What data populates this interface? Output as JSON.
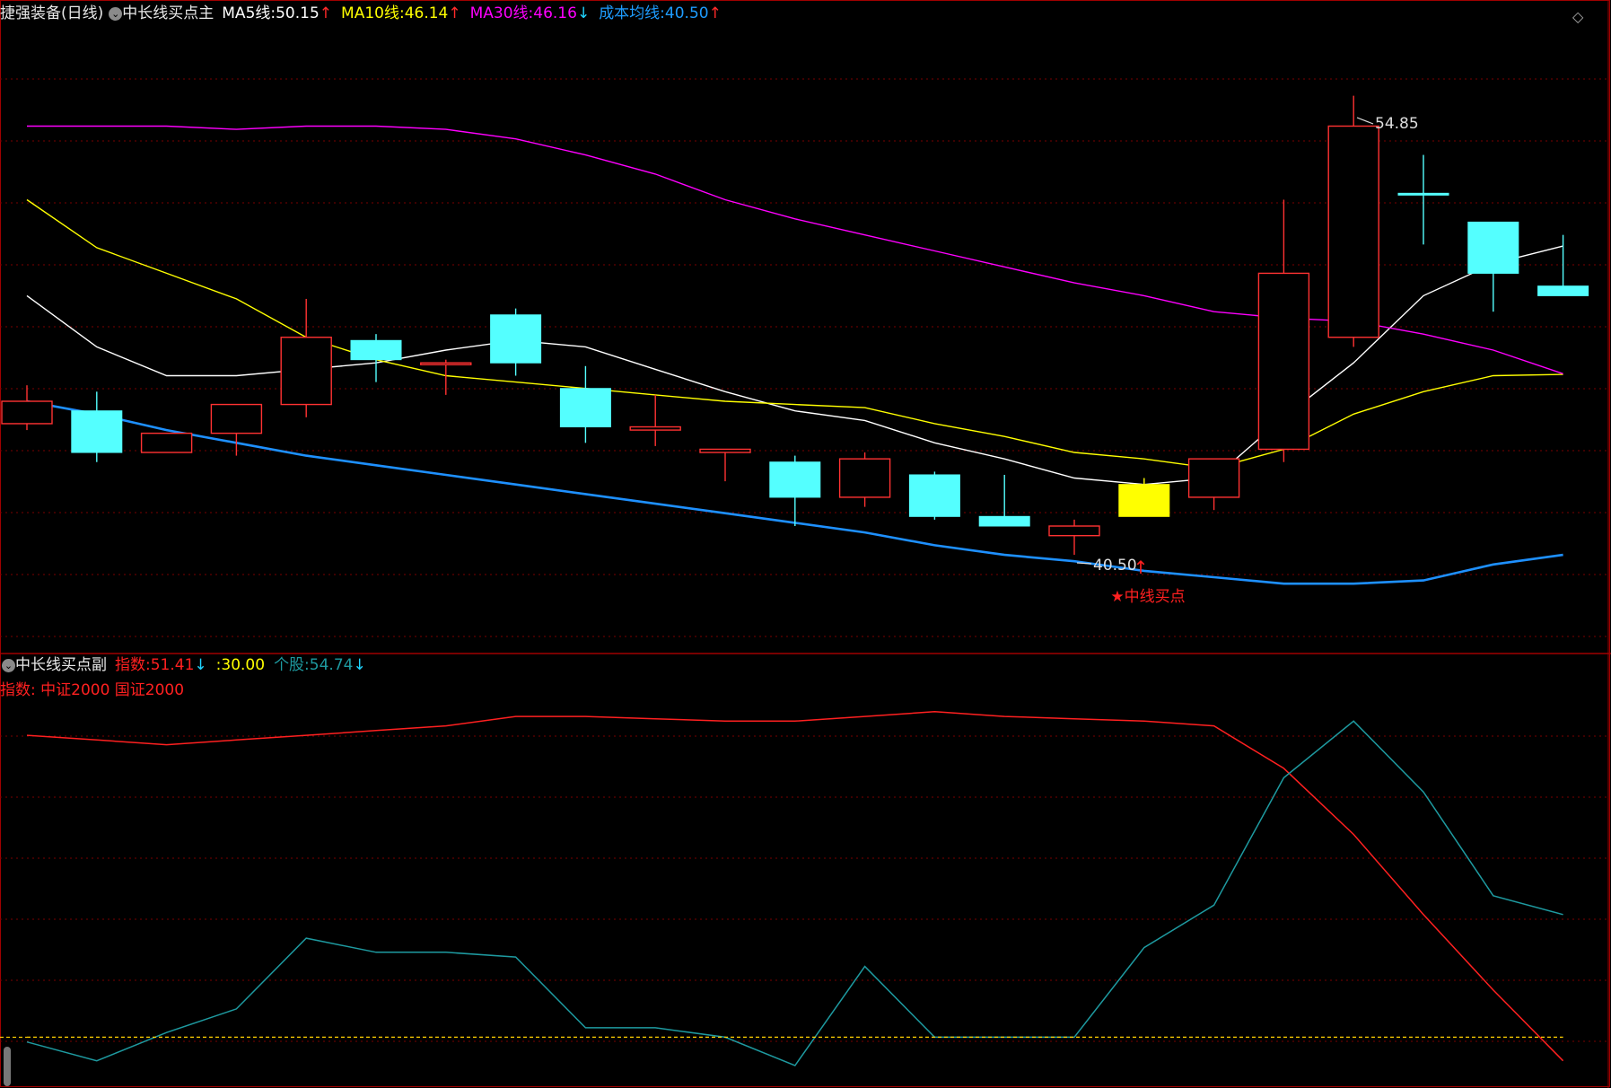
{
  "colors": {
    "bg": "#000000",
    "grid": "#7a0000",
    "frame": "#a00000",
    "up": "#ff3232",
    "down": "#54ffff",
    "highlight": "#ffff00",
    "ma5": "#ffffff",
    "ma10": "#ffff00",
    "ma30": "#ff00ff",
    "cost": "#1e90ff",
    "index_line": "#ff2020",
    "stock_line": "#1e9aa0",
    "threshold": "#ffd000"
  },
  "main": {
    "title": "捷强装备(日线)",
    "indicator_name": "中长线买点主",
    "legend": [
      {
        "label": "MA5线:",
        "value": "50.15",
        "arrow": "↑",
        "color": "#ffffff"
      },
      {
        "label": "MA10线:",
        "value": "46.14",
        "arrow": "↑",
        "color": "#ffff00"
      },
      {
        "label": "MA30线:",
        "value": "46.16",
        "arrow": "↓",
        "color": "#ff00ff"
      },
      {
        "label": "成本均线:",
        "value": "40.50",
        "arrow": "↑",
        "color": "#1e9cff"
      }
    ],
    "high_label": "54.85",
    "low_label": "40.50",
    "signal_label": "★中线买点",
    "diamond_icon": "◇"
  },
  "sub": {
    "indicator_name": "中长线买点副",
    "legend": [
      {
        "label": "指数:",
        "value": "51.41",
        "arrow": "↓",
        "color": "#ff2020"
      },
      {
        "label": ":",
        "value": "30.00",
        "arrow": "",
        "color": "#ffff00"
      },
      {
        "label": "个股:",
        "value": "54.74",
        "arrow": "↓",
        "color": "#1e9aa0"
      }
    ],
    "index_note": "指数: 中证2000 国证2000"
  },
  "chart_data": [
    {
      "type": "candlestick",
      "x": [
        1,
        2,
        3,
        4,
        5,
        6,
        7,
        8,
        9,
        10,
        11,
        12,
        13,
        14,
        15,
        16,
        17,
        18,
        19,
        20,
        21,
        22
      ],
      "candles": [
        {
          "o": 45.3,
          "h": 45.8,
          "l": 44.4,
          "c": 44.6,
          "dir": "up"
        },
        {
          "o": 45.0,
          "h": 45.6,
          "l": 43.4,
          "c": 43.7,
          "dir": "down"
        },
        {
          "o": 43.7,
          "h": 44.3,
          "l": 43.7,
          "c": 44.3,
          "dir": "up"
        },
        {
          "o": 44.3,
          "h": 45.2,
          "l": 43.6,
          "c": 45.2,
          "dir": "up"
        },
        {
          "o": 45.2,
          "h": 48.5,
          "l": 44.8,
          "c": 47.3,
          "dir": "up"
        },
        {
          "o": 47.2,
          "h": 47.4,
          "l": 45.9,
          "c": 46.6,
          "dir": "down"
        },
        {
          "o": 46.5,
          "h": 46.6,
          "l": 45.5,
          "c": 46.5,
          "dir": "up"
        },
        {
          "o": 48.0,
          "h": 48.2,
          "l": 46.1,
          "c": 46.5,
          "dir": "down"
        },
        {
          "o": 45.7,
          "h": 46.4,
          "l": 44.0,
          "c": 44.5,
          "dir": "down"
        },
        {
          "o": 44.4,
          "h": 45.5,
          "l": 43.9,
          "c": 44.5,
          "dir": "up"
        },
        {
          "o": 43.7,
          "h": 43.8,
          "l": 42.8,
          "c": 43.8,
          "dir": "up"
        },
        {
          "o": 43.4,
          "h": 43.6,
          "l": 41.4,
          "c": 42.3,
          "dir": "down"
        },
        {
          "o": 42.3,
          "h": 43.7,
          "l": 42.0,
          "c": 43.5,
          "dir": "up"
        },
        {
          "o": 43.0,
          "h": 43.1,
          "l": 41.6,
          "c": 41.7,
          "dir": "down"
        },
        {
          "o": 41.7,
          "h": 43.0,
          "l": 41.4,
          "c": 41.4,
          "dir": "down"
        },
        {
          "o": 41.1,
          "h": 41.6,
          "l": 40.5,
          "c": 41.4,
          "dir": "up"
        },
        {
          "o": 42.7,
          "h": 42.9,
          "l": 41.7,
          "c": 41.7,
          "dir": "down"
        },
        {
          "o": 42.3,
          "h": 43.5,
          "l": 41.9,
          "c": 43.5,
          "dir": "up"
        },
        {
          "o": 43.8,
          "h": 51.6,
          "l": 43.4,
          "c": 49.3,
          "dir": "up"
        },
        {
          "o": 47.3,
          "h": 54.85,
          "l": 47.0,
          "c": 53.9,
          "dir": "up"
        },
        {
          "o": 51.8,
          "h": 53.0,
          "l": 50.2,
          "c": 51.8,
          "dir": "down"
        },
        {
          "o": 50.9,
          "h": 50.9,
          "l": 48.1,
          "c": 49.3,
          "dir": "down"
        },
        {
          "o": 48.9,
          "h": 50.5,
          "l": 48.6,
          "c": 48.6,
          "dir": "down"
        }
      ],
      "highlight_index": 16,
      "series": [
        {
          "name": "MA5线",
          "values": [
            48.6,
            47.0,
            46.1,
            46.1,
            46.3,
            46.5,
            46.9,
            47.2,
            47.0,
            46.3,
            45.6,
            45.0,
            44.7,
            44.0,
            43.5,
            42.9,
            42.7,
            42.9,
            44.8,
            46.5,
            48.6,
            49.6,
            50.15
          ]
        },
        {
          "name": "MA10线",
          "values": [
            51.6,
            50.1,
            49.3,
            48.5,
            47.3,
            46.6,
            46.1,
            45.9,
            45.7,
            45.5,
            45.3,
            45.2,
            45.1,
            44.6,
            44.2,
            43.7,
            43.5,
            43.2,
            43.8,
            44.9,
            45.6,
            46.1,
            46.14
          ]
        },
        {
          "name": "MA30线",
          "values": [
            53.9,
            53.9,
            53.9,
            53.8,
            53.9,
            53.9,
            53.8,
            53.5,
            53.0,
            52.4,
            51.6,
            51.0,
            50.5,
            50.0,
            49.5,
            49.0,
            48.6,
            48.1,
            47.9,
            47.8,
            47.4,
            46.9,
            46.16
          ]
        },
        {
          "name": "成本均线",
          "values": [
            45.3,
            44.9,
            44.4,
            44.0,
            43.6,
            43.3,
            43.0,
            42.7,
            42.4,
            42.1,
            41.8,
            41.5,
            41.2,
            40.8,
            40.5,
            40.3,
            40.0,
            39.8,
            39.6,
            39.6,
            39.7,
            40.2,
            40.5
          ]
        }
      ],
      "ylim": [
        37.5,
        57.0
      ]
    },
    {
      "type": "line",
      "x": [
        1,
        2,
        3,
        4,
        5,
        6,
        7,
        8,
        9,
        10,
        11,
        12,
        13,
        14,
        15,
        16,
        17,
        18,
        19,
        20,
        21,
        22
      ],
      "series": [
        {
          "name": "指数",
          "values": [
            94,
            93,
            92,
            93,
            94,
            95,
            96,
            98,
            98,
            97.5,
            97,
            97,
            98,
            99,
            98,
            97.5,
            97,
            96,
            87,
            73,
            56,
            40,
            25
          ]
        },
        {
          "name": "个股",
          "values": [
            29,
            25,
            31,
            36,
            51,
            48,
            48,
            47,
            32,
            32,
            30,
            24,
            45,
            30,
            30,
            30,
            49,
            58,
            85,
            97,
            82,
            60,
            56
          ]
        },
        {
          "name": "",
          "values": [
            30,
            30,
            30,
            30,
            30,
            30,
            30,
            30,
            30,
            30,
            30,
            30,
            30,
            30,
            30,
            30,
            30,
            30,
            30,
            30,
            30,
            30,
            30
          ]
        }
      ],
      "ylim": [
        20,
        110
      ]
    }
  ]
}
